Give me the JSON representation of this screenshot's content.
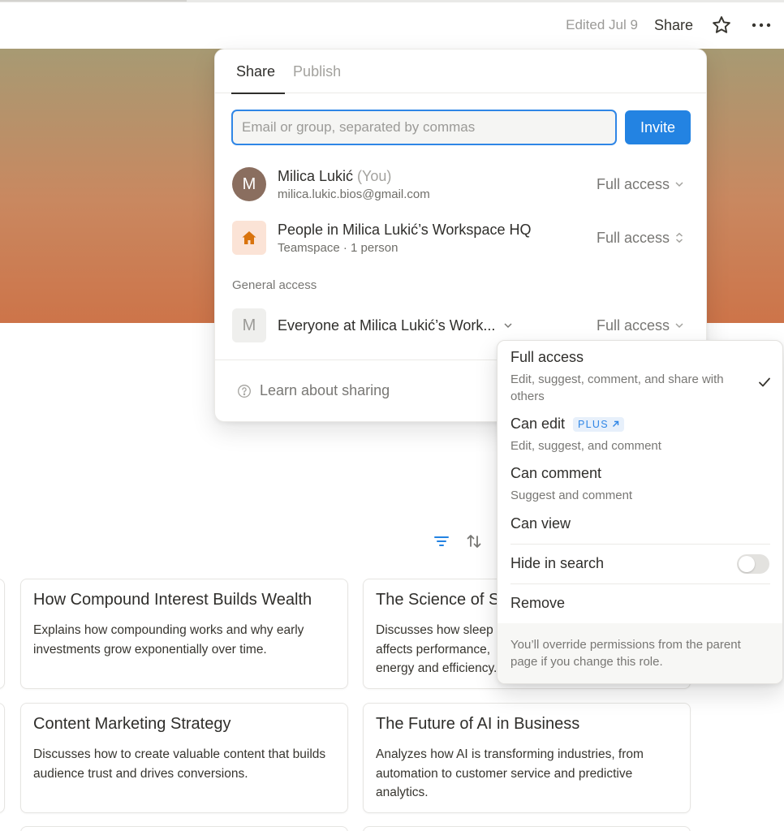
{
  "topbar": {
    "edited": "Edited Jul 9",
    "share_label": "Share"
  },
  "cards": [
    {
      "title": "How Compound Interest Builds Wealth",
      "desc": "Explains how compounding works and why early investments grow exponentially over time."
    },
    {
      "title": "The Science of Sleep",
      "desc": "Discusses how sleep affects performance, energy and efficiency."
    },
    {
      "title": "Content Marketing Strategy",
      "desc": "Discusses how to create valuable content that builds audience trust and drives conversions."
    },
    {
      "title": "The Future of AI in Business",
      "desc": "Analyzes how AI is transforming industries, from automation to customer service and predictive analytics."
    }
  ],
  "share_panel": {
    "tabs": [
      "Share",
      "Publish"
    ],
    "email_placeholder": "Email or group, separated by commas",
    "invite_label": "Invite",
    "members": [
      {
        "initial": "M",
        "name": "Milica Lukić",
        "tag": "(You)",
        "sub": "milica.lukic.bios@gmail.com",
        "access": "Full access"
      },
      {
        "name": "People in Milica Lukić’s Workspace HQ",
        "sub": "Teamspace · 1 person",
        "access": "Full access"
      }
    ],
    "general_label": "General access",
    "general": {
      "initial": "M",
      "name": "Everyone at Milica Lukić’s Work...",
      "access": "Full access"
    },
    "learn_label": "Learn about sharing"
  },
  "access_menu": {
    "options": [
      {
        "title": "Full access",
        "desc": "Edit, suggest, comment, and share with others",
        "selected": true
      },
      {
        "title": "Can edit",
        "badge": "PLUS",
        "desc": "Edit, suggest, and comment"
      },
      {
        "title": "Can comment",
        "desc": "Suggest and comment"
      },
      {
        "title": "Can view"
      }
    ],
    "hide_in_search": "Hide in search",
    "hide_in_search_on": false,
    "remove": "Remove",
    "footer": "You’ll override permissions from the parent page if you change this role."
  },
  "colors": {
    "accent": "#2383e2",
    "cover_top": "#a79a73",
    "cover_bottom": "#cd7449"
  }
}
